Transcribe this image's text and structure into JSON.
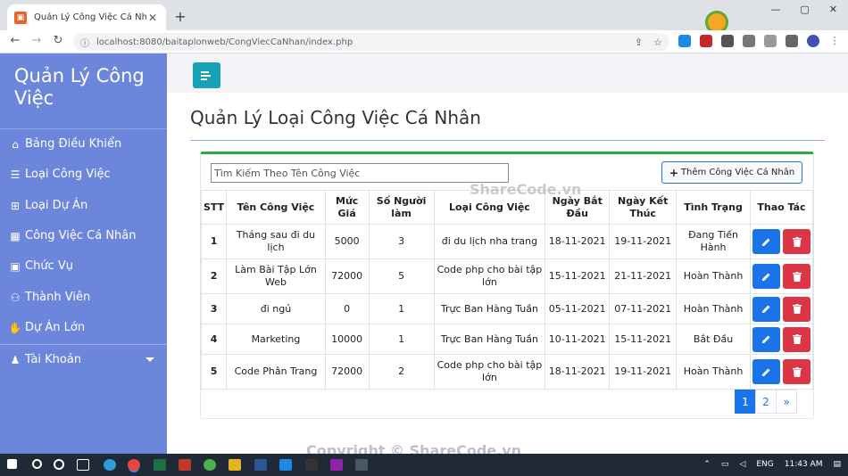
{
  "browser": {
    "tab_title": "Quản Lý Công Việc Cá Nhân",
    "url_host": "localhost",
    "url_rest": ":8080/baitaplonweb/CongViecCaNhan/index.php",
    "new_tab": "+",
    "close_tab": "✕"
  },
  "brand_logo_text": "SHARECODE.vn",
  "sidebar": {
    "title": "Quản Lý Công Việc",
    "items": [
      {
        "label": "Bảng Điều Khiển",
        "icon": "home-icon"
      },
      {
        "label": "Loại Công Việc",
        "icon": "list-icon"
      },
      {
        "label": "Loại Dự Án",
        "icon": "sitemap-icon"
      },
      {
        "label": "Công Việc Cá Nhân",
        "icon": "calendar-icon"
      },
      {
        "label": "Chức Vụ",
        "icon": "calendar-check-icon"
      },
      {
        "label": "Thành Viên",
        "icon": "users-icon"
      },
      {
        "label": "Dự Án Lớn",
        "icon": "handshake-icon"
      },
      {
        "label": "Tài Khoản",
        "icon": "user-icon"
      }
    ]
  },
  "main": {
    "page_title": "Quản Lý Loại Công Việc Cá Nhân",
    "search_placeholder": "Tìm Kiếm Theo Tên Công Việc",
    "add_button": "Thêm Công Việc Cá Nhân",
    "columns": [
      "STT",
      "Tên Công Việc",
      "Mức Giá",
      "Số Người làm",
      "Loại Công Việc",
      "Ngày Bắt Đầu",
      "Ngày Kết Thúc",
      "Tình Trạng",
      "Thao Tác"
    ],
    "rows": [
      {
        "stt": "1",
        "name": "Tháng sau đi du lịch",
        "price": "5000",
        "people": "3",
        "type": "đi du lịch nha trang",
        "start": "18-11-2021",
        "end": "19-11-2021",
        "status": "Đang Tiến Hành"
      },
      {
        "stt": "2",
        "name": "Làm Bài Tập Lớn Web",
        "price": "72000",
        "people": "5",
        "type": "Code php cho bài tập lớn",
        "start": "15-11-2021",
        "end": "21-11-2021",
        "status": "Hoàn Thành"
      },
      {
        "stt": "3",
        "name": "đi ngủ",
        "price": "0",
        "people": "1",
        "type": "Trực Ban Hàng Tuần",
        "start": "05-11-2021",
        "end": "07-11-2021",
        "status": "Hoàn Thành"
      },
      {
        "stt": "4",
        "name": "Marketing",
        "price": "10000",
        "people": "1",
        "type": "Trực Ban Hàng Tuần",
        "start": "10-11-2021",
        "end": "15-11-2021",
        "status": "Bắt Đầu"
      },
      {
        "stt": "5",
        "name": "Code Phân Trang",
        "price": "72000",
        "people": "2",
        "type": "Code php cho bài tập lớn",
        "start": "18-11-2021",
        "end": "19-11-2021",
        "status": "Hoàn Thành"
      }
    ],
    "pagination": [
      "1",
      "2",
      "»"
    ]
  },
  "watermark": "Copyright © ShareCode.vn",
  "watermark_mid": "ShareCode.vn",
  "taskbar": {
    "lang": "ENG",
    "time": "11:43 AM"
  },
  "colors": {
    "sidebar": "#6c86dc",
    "toggle": "#17a2b8",
    "edit": "#1a73e8",
    "delete": "#dc3545",
    "card_top": "#28a745"
  }
}
